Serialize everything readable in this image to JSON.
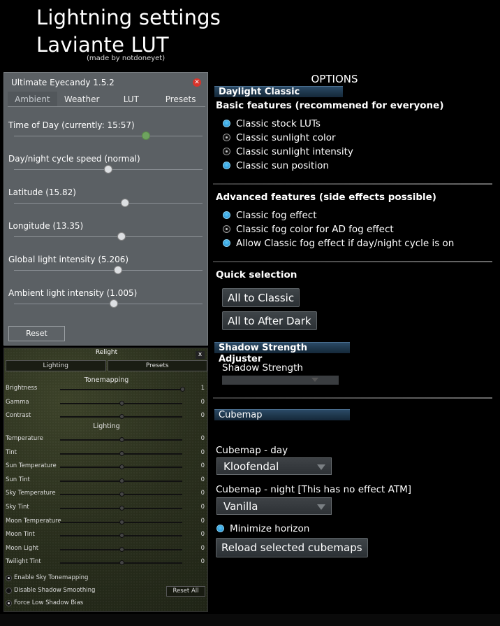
{
  "header": {
    "line1": "Lightning settings",
    "line2": "Laviante LUT",
    "credit": "(made by notdoneyet)"
  },
  "eyecandy": {
    "title": "Ultimate Eyecandy 1.5.2",
    "close_icon": "close-icon",
    "tabs": [
      "Ambient",
      "Weather",
      "LUT",
      "Presets"
    ],
    "active_tab": "Ambient",
    "sliders": [
      {
        "label": "Time of Day (currently: 15:57)",
        "level": 0.7,
        "accent": "#6ea35f"
      },
      {
        "label": "Day/night cycle speed (normal)",
        "level": 0.5
      },
      {
        "label": "Latitude (15.82)",
        "level": 0.59
      },
      {
        "label": "Longitude (13.35)",
        "level": 0.57
      },
      {
        "label": "Global light intensity (5.206)",
        "level": 0.55
      },
      {
        "label": "Ambient light intensity (1.005)",
        "level": 0.53
      }
    ],
    "reset_label": "Reset"
  },
  "relight": {
    "title": "Relight",
    "close_label": "x",
    "tabs": [
      "Lighting",
      "Presets"
    ],
    "tonemapping_header": "Tonemapping",
    "tonemapping": [
      {
        "label": "Brightness",
        "value": "1",
        "level": 1.0
      },
      {
        "label": "Gamma",
        "value": "0",
        "level": 0.5
      },
      {
        "label": "Contrast",
        "value": "0",
        "level": 0.5
      }
    ],
    "lighting_header": "Lighting",
    "lighting": [
      {
        "label": "Temperature",
        "value": "0",
        "level": 0.5
      },
      {
        "label": "Tint",
        "value": "0",
        "level": 0.5
      },
      {
        "label": "Sun Temperature",
        "value": "0",
        "level": 0.5
      },
      {
        "label": "Sun Tint",
        "value": "0",
        "level": 0.5
      },
      {
        "label": "Sky Temperature",
        "value": "0",
        "level": 0.5
      },
      {
        "label": "Sky Tint",
        "value": "0",
        "level": 0.5
      },
      {
        "label": "Moon Temperature",
        "value": "0",
        "level": 0.5
      },
      {
        "label": "Moon Tint",
        "value": "0",
        "level": 0.5
      },
      {
        "label": "Moon Light",
        "value": "0",
        "level": 0.5
      },
      {
        "label": "Twilight Tint",
        "value": "0",
        "level": 0.5
      }
    ],
    "checks": [
      {
        "label": "Enable Sky Tonemapping",
        "on": true
      },
      {
        "label": "Disable Shadow Smoothing",
        "on": false
      },
      {
        "label": "Force Low Shadow Bias",
        "on": true
      }
    ],
    "reset_all_label": "Reset All"
  },
  "options": {
    "title": "OPTIONS",
    "daylight_header": "Daylight Classic",
    "basic_label": "Basic features (recommened for everyone)",
    "basic_items": [
      {
        "label": "Classic stock LUTs",
        "on": true
      },
      {
        "label": "Classic sunlight color",
        "on": false
      },
      {
        "label": "Classic sunlight intensity",
        "on": false
      },
      {
        "label": "Classic sun position",
        "on": true
      }
    ],
    "advanced_label": "Advanced features (side effects possible)",
    "advanced_items": [
      {
        "label": "Classic fog effect",
        "on": true
      },
      {
        "label": "Classic fog color for AD fog effect",
        "on": false
      },
      {
        "label": "Allow Classic fog effect if day/night cycle is on",
        "on": true
      }
    ],
    "quick_label": "Quick selection",
    "all_classic": "All to Classic",
    "all_afterdark": "All to After Dark",
    "shadow_header": "Shadow Strength Adjuster",
    "shadow_label": "Shadow Strength",
    "cubemap_header": "Cubemap",
    "cubemap_day_label": "Cubemap - day",
    "cubemap_day_value": "Kloofendal",
    "cubemap_night_label": "Cubemap - night [This has no effect ATM]",
    "cubemap_night_value": "Vanilla",
    "minimize_horizon": "Minimize horizon",
    "minimize_on": true,
    "reload_label": "Reload selected cubemaps"
  }
}
